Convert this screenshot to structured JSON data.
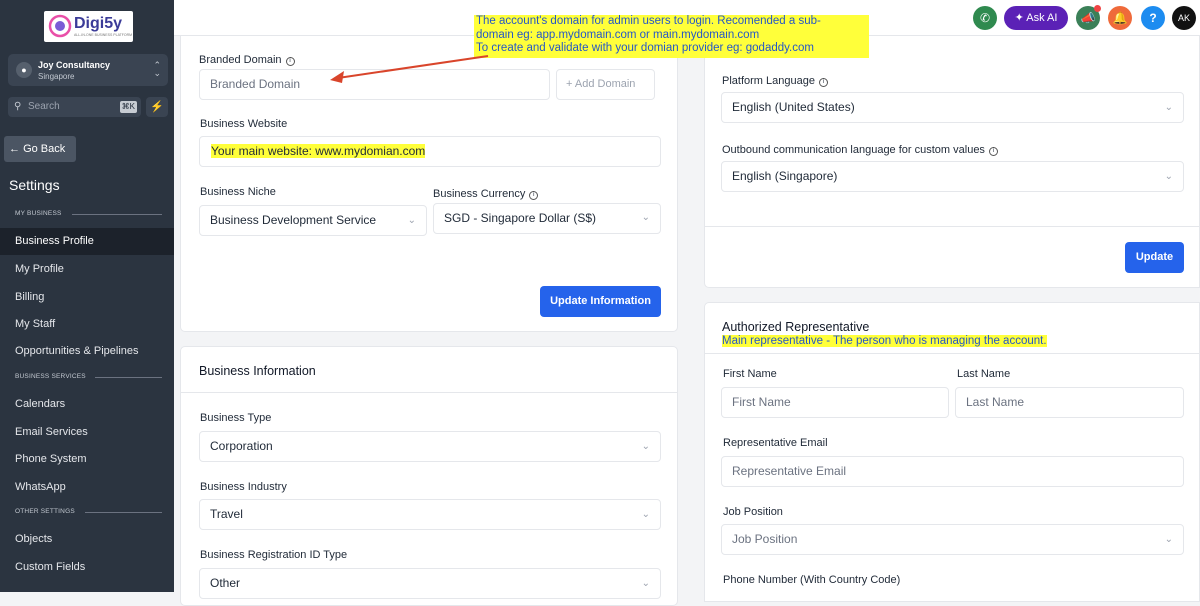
{
  "brand": {
    "name": "Digi5y",
    "tagline": "ALL-IN-ONE BUSINESS PLATFORM"
  },
  "account": {
    "name": "Joy Consultancy",
    "location": "Singapore"
  },
  "search": {
    "placeholder": "Search",
    "shortcut": "⌘K"
  },
  "nav": {
    "go_back": "Go Back",
    "title": "Settings",
    "sections": {
      "my_business": "MY BUSINESS",
      "business_services": "BUSINESS SERVICES",
      "other_settings": "OTHER SETTINGS"
    },
    "items": [
      "Business Profile",
      "My Profile",
      "Billing",
      "My Staff",
      "Opportunities & Pipelines",
      "Calendars",
      "Email Services",
      "Phone System",
      "WhatsApp",
      "Objects",
      "Custom Fields"
    ]
  },
  "topbar": {
    "ask_ai": "Ask AI",
    "help": "?",
    "user_initials": "AK"
  },
  "colors": {
    "primary": "#2563eb",
    "sidebar": "#2b3440",
    "highlight": "#ffff3a",
    "phone_btn": "#2f8a4f",
    "ask_ai": "#5b21b6",
    "megaphone": "#3b8058",
    "bell": "#ef6a3a",
    "help_btn": "#1d8cf0"
  },
  "annotation": {
    "lines": [
      "The account's domain for admin users to login. Recomended a sub-",
      "domain eg: app.mydomain.com or main.mydomain.com",
      "To create and validate with your domian provider eg: godaddy.com"
    ]
  },
  "general": {
    "branded_domain_label": "Branded Domain",
    "branded_domain_placeholder": "Branded Domain",
    "add_domain": "+ Add Domain",
    "website_label": "Business Website",
    "website_value": "Your main website: www.mydomian.com",
    "niche_label": "Business Niche",
    "niche_value": "Business Development Service",
    "currency_label": "Business Currency",
    "currency_value": "SGD - Singapore Dollar (S$)",
    "update_button": "Update Information"
  },
  "business_info": {
    "title": "Business Information",
    "type_label": "Business Type",
    "type_value": "Corporation",
    "industry_label": "Business Industry",
    "industry_value": "Travel",
    "reg_id_label": "Business Registration ID Type",
    "reg_id_value": "Other"
  },
  "language": {
    "platform_label": "Platform Language",
    "platform_value": "English (United States)",
    "outbound_label": "Outbound communication language for custom values",
    "outbound_value": "English (Singapore)",
    "update_button": "Update"
  },
  "representative": {
    "title": "Authorized Representative",
    "note": "Main representative - The person who is managing the account.",
    "first_name_label": "First Name",
    "first_name_placeholder": "First Name",
    "last_name_label": "Last Name",
    "last_name_placeholder": "Last Name",
    "email_label": "Representative Email",
    "email_placeholder": "Representative Email",
    "job_label": "Job Position",
    "job_placeholder": "Job Position",
    "phone_label": "Phone Number (With Country Code)"
  }
}
